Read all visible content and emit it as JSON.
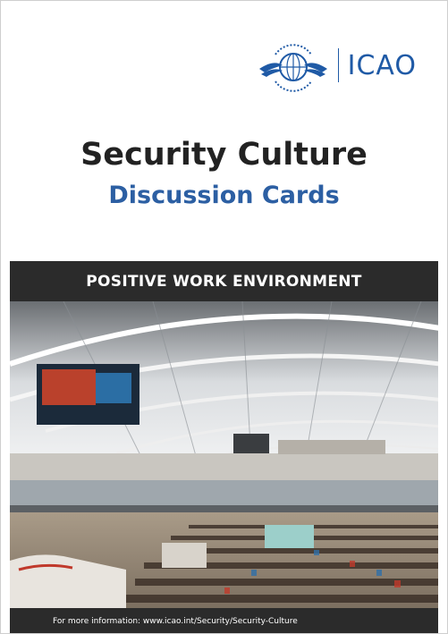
{
  "logo": {
    "org_name": "ICAO",
    "emblem_icon": "icao-emblem-icon",
    "accent_color": "#1f5aa6"
  },
  "cover": {
    "title": "Security Culture",
    "subtitle": "Discussion Cards",
    "section": "POSITIVE WORK ENVIRONMENT",
    "photo_subject": "airport-terminal-photo",
    "footer_text": "For more information: www.icao.int/Security/Security-Culture"
  },
  "colors": {
    "title": "#222222",
    "subtitle": "#2c5fa3",
    "banner": "#2b2b2b"
  }
}
